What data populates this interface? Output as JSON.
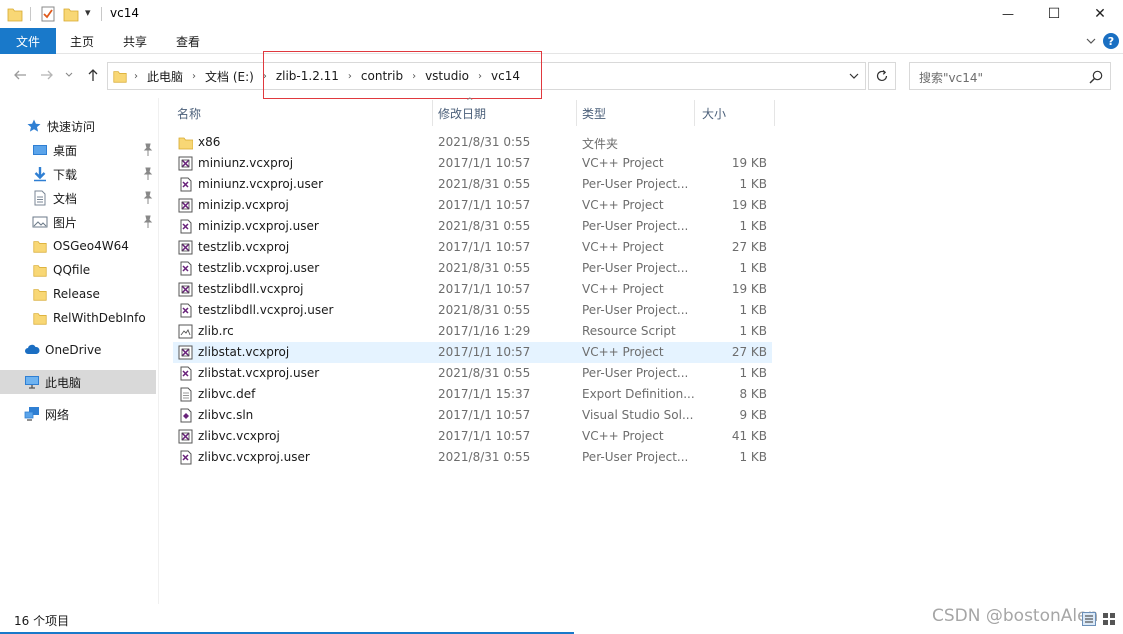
{
  "window": {
    "title": "vc14",
    "qa_dropdown_glyph": "▾",
    "minimize_glyph": "—",
    "maximize_glyph": "☐",
    "close_glyph": "✕"
  },
  "ribbon": {
    "file_tab": "文件",
    "tabs": [
      "主页",
      "共享",
      "查看"
    ],
    "help_glyph": "?"
  },
  "address_bar": {
    "root_arrow": "›",
    "crumbs": [
      "此电脑",
      "文档 (E:)",
      "zlib-1.2.11",
      "contrib",
      "vstudio",
      "vc14"
    ],
    "separator": "›"
  },
  "search": {
    "placeholder": "搜索\"vc14\""
  },
  "nav_pane": {
    "items": [
      {
        "label": "快速访问",
        "icon": "star-icon",
        "pinned": false
      },
      {
        "label": "桌面",
        "icon": "desktop-icon",
        "pinned": true
      },
      {
        "label": "下载",
        "icon": "download-icon",
        "pinned": true
      },
      {
        "label": "文档",
        "icon": "document-icon",
        "pinned": true
      },
      {
        "label": "图片",
        "icon": "picture-icon",
        "pinned": true
      },
      {
        "label": "OSGeo4W64",
        "icon": "folder-icon",
        "pinned": false
      },
      {
        "label": "QQfile",
        "icon": "folder-icon",
        "pinned": false
      },
      {
        "label": "Release",
        "icon": "folder-icon",
        "pinned": false
      },
      {
        "label": "RelWithDebInfo",
        "icon": "folder-icon",
        "pinned": false
      },
      {
        "label": "OneDrive",
        "icon": "cloud-icon",
        "pinned": false
      },
      {
        "label": "此电脑",
        "icon": "computer-icon",
        "pinned": false
      },
      {
        "label": "网络",
        "icon": "network-icon",
        "pinned": false
      }
    ]
  },
  "columns": {
    "name": "名称",
    "date": "修改日期",
    "type": "类型",
    "size": "大小",
    "sort_glyph": "^"
  },
  "files": [
    {
      "name": "x86",
      "date": "2021/8/31 0:55",
      "type": "文件夹",
      "size": "",
      "icon": "folder-icon"
    },
    {
      "name": "miniunz.vcxproj",
      "date": "2017/1/1 10:57",
      "type": "VC++ Project",
      "size": "19 KB",
      "icon": "vcxproj-icon"
    },
    {
      "name": "miniunz.vcxproj.user",
      "date": "2021/8/31 0:55",
      "type": "Per-User Project...",
      "size": "1 KB",
      "icon": "vs-user-icon"
    },
    {
      "name": "minizip.vcxproj",
      "date": "2017/1/1 10:57",
      "type": "VC++ Project",
      "size": "19 KB",
      "icon": "vcxproj-icon"
    },
    {
      "name": "minizip.vcxproj.user",
      "date": "2021/8/31 0:55",
      "type": "Per-User Project...",
      "size": "1 KB",
      "icon": "vs-user-icon"
    },
    {
      "name": "testzlib.vcxproj",
      "date": "2017/1/1 10:57",
      "type": "VC++ Project",
      "size": "27 KB",
      "icon": "vcxproj-icon"
    },
    {
      "name": "testzlib.vcxproj.user",
      "date": "2021/8/31 0:55",
      "type": "Per-User Project...",
      "size": "1 KB",
      "icon": "vs-user-icon"
    },
    {
      "name": "testzlibdll.vcxproj",
      "date": "2017/1/1 10:57",
      "type": "VC++ Project",
      "size": "19 KB",
      "icon": "vcxproj-icon"
    },
    {
      "name": "testzlibdll.vcxproj.user",
      "date": "2021/8/31 0:55",
      "type": "Per-User Project...",
      "size": "1 KB",
      "icon": "vs-user-icon"
    },
    {
      "name": "zlib.rc",
      "date": "2017/1/16 1:29",
      "type": "Resource Script",
      "size": "1 KB",
      "icon": "rc-icon"
    },
    {
      "name": "zlibstat.vcxproj",
      "date": "2017/1/1 10:57",
      "type": "VC++ Project",
      "size": "27 KB",
      "icon": "vcxproj-icon",
      "hover": true
    },
    {
      "name": "zlibstat.vcxproj.user",
      "date": "2021/8/31 0:55",
      "type": "Per-User Project...",
      "size": "1 KB",
      "icon": "vs-user-icon"
    },
    {
      "name": "zlibvc.def",
      "date": "2017/1/1 15:37",
      "type": "Export Definition...",
      "size": "8 KB",
      "icon": "text-file-icon"
    },
    {
      "name": "zlibvc.sln",
      "date": "2017/1/1 10:57",
      "type": "Visual Studio Sol...",
      "size": "9 KB",
      "icon": "vs-solution-icon"
    },
    {
      "name": "zlibvc.vcxproj",
      "date": "2017/1/1 10:57",
      "type": "VC++ Project",
      "size": "41 KB",
      "icon": "vcxproj-icon"
    },
    {
      "name": "zlibvc.vcxproj.user",
      "date": "2021/8/31 0:55",
      "type": "Per-User Project...",
      "size": "1 KB",
      "icon": "vs-user-icon"
    }
  ],
  "status": {
    "item_count": "16 个项目"
  },
  "watermark": "CSDN @bostonAlen",
  "colors": {
    "accent": "#1979ca",
    "highlight_box": "#e0393e",
    "hover_row": "#e5f3ff",
    "selected_nav": "#d9d9d9",
    "folder": "#f8d775",
    "vs_purple": "#68217a"
  }
}
